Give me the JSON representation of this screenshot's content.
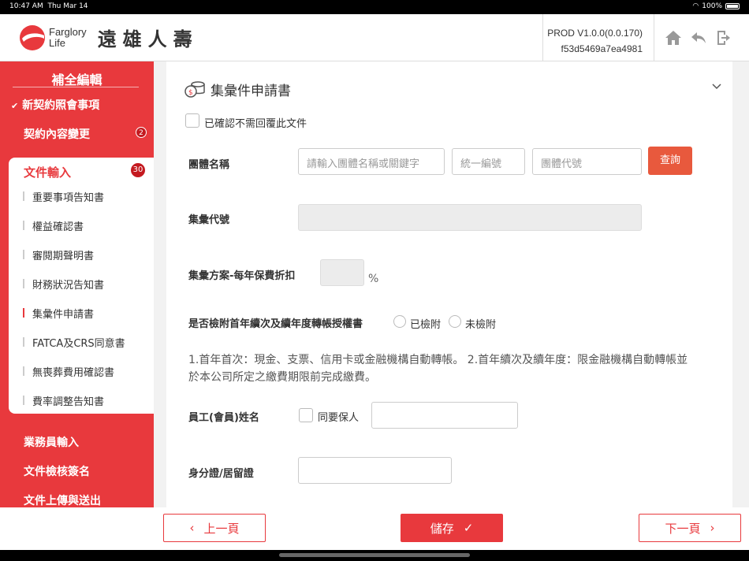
{
  "status": {
    "time": "10:47 AM",
    "date": "Thu Mar 14",
    "battery": "100%"
  },
  "header": {
    "logo_en_1": "Farglory",
    "logo_en_2": "Life",
    "logo_zh": "遠雄人壽",
    "version": "PROD V1.0.0(0.0.170)",
    "build": "f53d5469a7ea4981"
  },
  "sidebar": {
    "title": "補全編輯",
    "top_items": [
      {
        "label": "新契約照會事項",
        "checked": true
      },
      {
        "label": "契約內容變更",
        "badge": "2"
      }
    ],
    "doc_section": {
      "label": "文件輸入",
      "badge": "30"
    },
    "doc_items": [
      "重要事項告知書",
      "權益確認書",
      "審閱期聲明書",
      "財務狀況告知書",
      "集彙件申請書",
      "FATCA及CRS同意書",
      "無喪葬費用確認書",
      "費率調整告知書"
    ],
    "bottom_items": [
      "業務員輸入",
      "文件檢核簽名",
      "文件上傳與送出"
    ]
  },
  "form": {
    "title": "集彙件申請書",
    "confirm_label": "已確認不需回覆此文件",
    "group_name_label": "團體名稱",
    "group_name_placeholder": "請輸入團體名稱或關鍵字",
    "tax_id_placeholder": "統一編號",
    "group_code_placeholder": "團體代號",
    "query_label": "查詢",
    "collect_code_label": "集彙代號",
    "discount_label": "集彙方案-每年保費折扣",
    "percent": "%",
    "auth_label": "是否檢附首年續次及續年度轉帳授權書",
    "attached": "已檢附",
    "not_attached": "未檢附",
    "note": "1.首年首次：現金、支票、信用卡或金融機構自動轉帳。 2.首年續次及續年度：限金融機構自動轉帳並於本公司所定之繳費期限前完成繳費。",
    "employee_label": "員工(會員)姓名",
    "same_insured": "同要保人",
    "id_label": "身分證/居留證"
  },
  "footer": {
    "prev": "上一頁",
    "save": "儲存",
    "next": "下一頁"
  },
  "colors": {
    "brand_red": "#e8393d",
    "query_btn": "#e8593d"
  }
}
